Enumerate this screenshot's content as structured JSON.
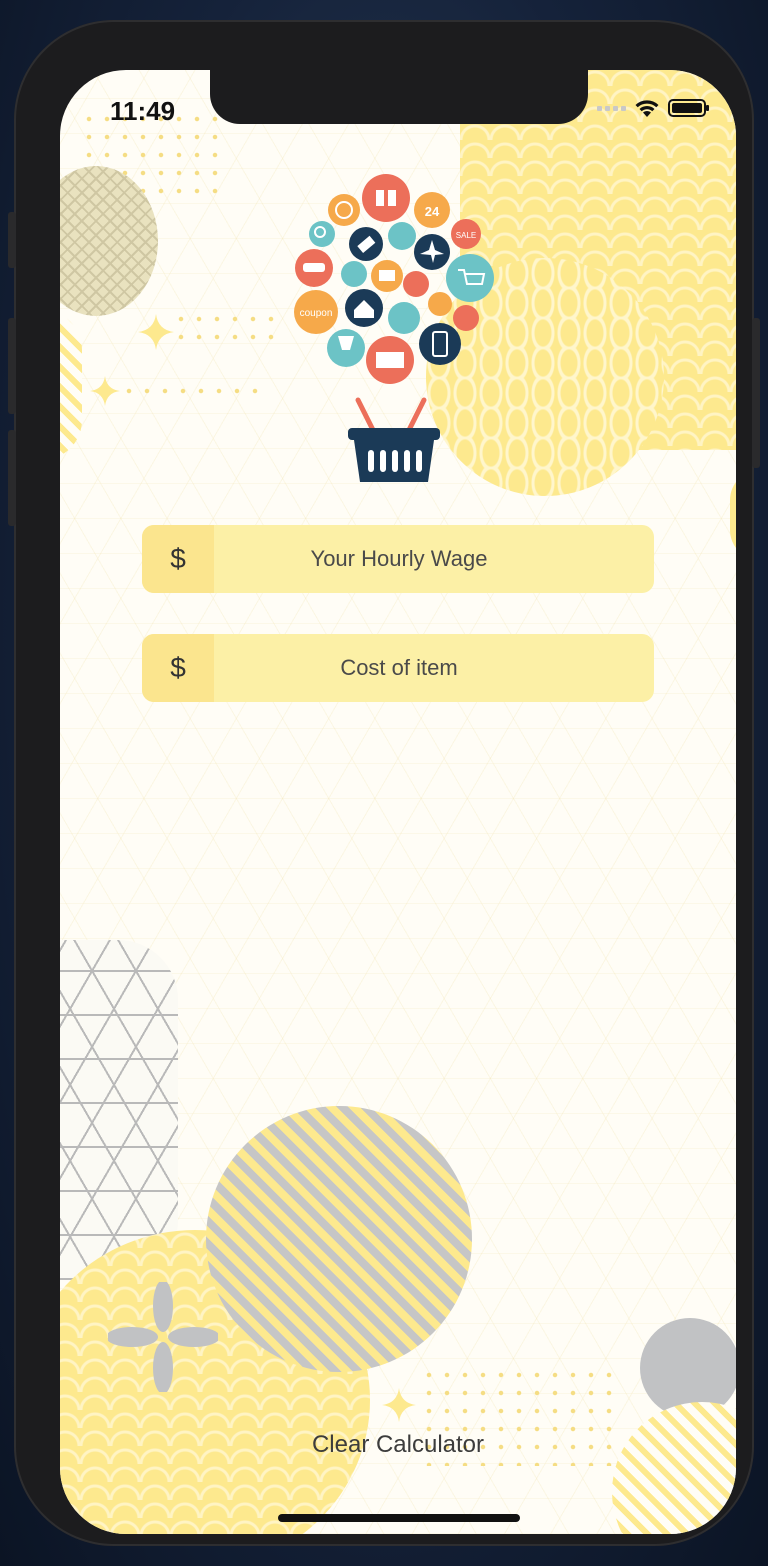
{
  "status_bar": {
    "time": "11:49"
  },
  "form": {
    "wage": {
      "prefix": "$",
      "placeholder": "Your Hourly Wage"
    },
    "cost": {
      "prefix": "$",
      "placeholder": "Cost of item"
    }
  },
  "actions": {
    "clear_label": "Clear Calculator"
  },
  "logo": {
    "coupon_text": "coupon",
    "hours_text": "24",
    "sale_text": "SALE"
  },
  "colors": {
    "accent_yellow": "#fde98e",
    "field_bg": "#fcf0a6",
    "navy": "#1b3a57",
    "coral": "#ec6f5a",
    "teal": "#6cc3c6",
    "orange": "#f6a94a",
    "gray": "#c1c2c4"
  }
}
